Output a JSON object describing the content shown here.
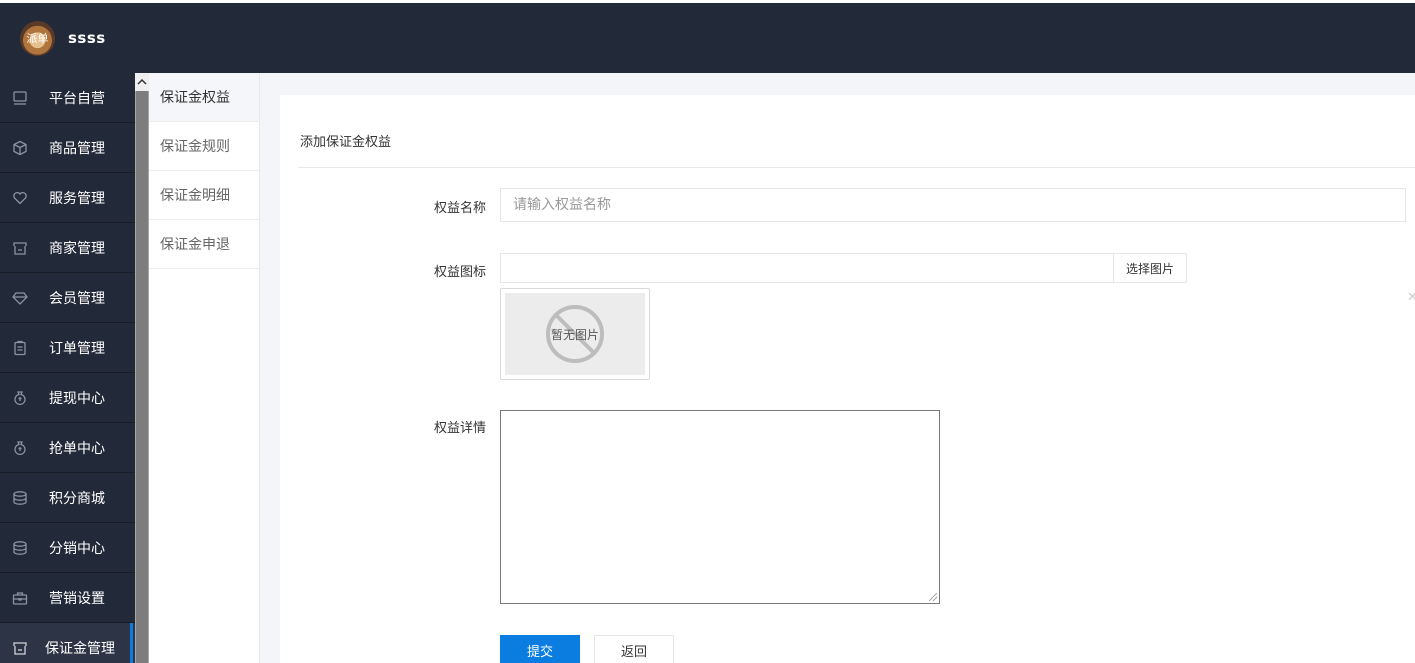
{
  "header": {
    "brand": "ssss",
    "avatar_text": "派单"
  },
  "sidebar": {
    "items": [
      {
        "label": "平台自营",
        "icon": "monitor-icon"
      },
      {
        "label": "商品管理",
        "icon": "box-icon"
      },
      {
        "label": "服务管理",
        "icon": "heart-icon"
      },
      {
        "label": "商家管理",
        "icon": "store-icon"
      },
      {
        "label": "会员管理",
        "icon": "diamond-icon"
      },
      {
        "label": "订单管理",
        "icon": "clipboard-icon"
      },
      {
        "label": "提现中心",
        "icon": "money-bag-icon"
      },
      {
        "label": "抢单中心",
        "icon": "money-bag-icon"
      },
      {
        "label": "积分商城",
        "icon": "coins-icon"
      },
      {
        "label": "分销中心",
        "icon": "coins-icon"
      },
      {
        "label": "营销设置",
        "icon": "toolbox-icon"
      },
      {
        "label": "保证金管理",
        "icon": "store-icon",
        "active": true
      }
    ]
  },
  "subnav": {
    "items": [
      {
        "label": "保证金权益",
        "active": true
      },
      {
        "label": "保证金规则"
      },
      {
        "label": "保证金明细"
      },
      {
        "label": "保证金申退"
      }
    ]
  },
  "form": {
    "title": "添加保证金权益",
    "name_label": "权益名称",
    "name_placeholder": "请输入权益名称",
    "name_value": "",
    "icon_label": "权益图标",
    "icon_value": "",
    "select_image_button": "选择图片",
    "no_image_text": "暂无图片",
    "detail_label": "权益详情",
    "detail_value": "",
    "submit_button": "提交",
    "back_button": "返回"
  },
  "colors": {
    "topbar": "#222938",
    "sidebar": "#222938",
    "accent": "#0b7de0",
    "content_bg": "#f3f5f8"
  }
}
